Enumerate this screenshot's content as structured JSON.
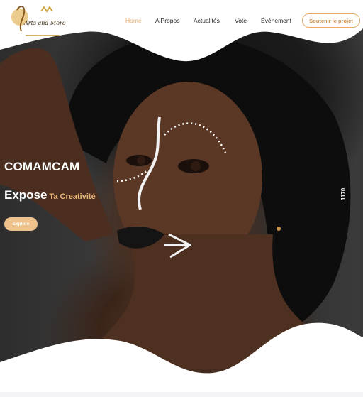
{
  "header": {
    "logo_icon": "arts-and-more-logo",
    "logo_text": "Arts and More",
    "nav": [
      {
        "label": "Home",
        "active": true
      },
      {
        "label": "A Propos",
        "active": false
      },
      {
        "label": "Actualités",
        "active": false
      },
      {
        "label": "Vote",
        "active": false
      },
      {
        "label": "Événement",
        "active": false
      }
    ],
    "cta_label": "Soutenir le projet"
  },
  "hero": {
    "title": "COMAMCAM",
    "subtitle_main": "Expose",
    "subtitle_accent": "Ta Creativité",
    "button_label": "Explore",
    "side_counter": "1170",
    "image_icon": "woman-portrait-face-paint"
  },
  "colors": {
    "accent": "#e3b075",
    "button_fill": "#efc28c",
    "nav_text": "#222222",
    "hero_text": "#ffffff"
  }
}
